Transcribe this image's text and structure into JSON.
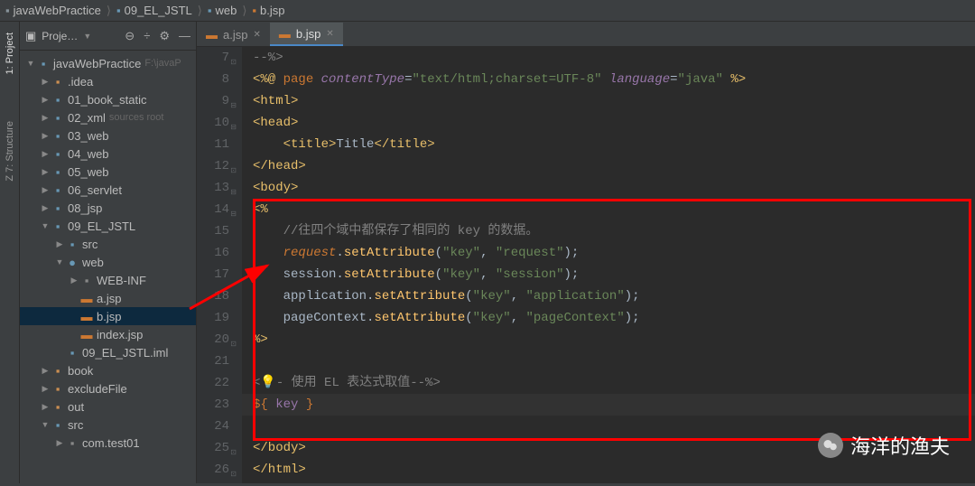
{
  "breadcrumb": [
    "javaWebPractice",
    "09_EL_JSTL",
    "web",
    "b.jsp"
  ],
  "sidebarTabs": [
    {
      "label": "1: Project",
      "active": true
    },
    {
      "label": "Z 7: Structure",
      "active": false
    }
  ],
  "projectPanel": {
    "title": "Proje…",
    "toolbarIcons": [
      "collapse-icon",
      "divide-icon",
      "gear-icon",
      "hide-icon"
    ]
  },
  "tree": [
    {
      "depth": 0,
      "arrow": "down",
      "icon": "project",
      "iconClass": "folder-blue",
      "label": "javaWebPractice",
      "hint": "F:\\javaP"
    },
    {
      "depth": 1,
      "arrow": "right",
      "icon": "folder",
      "iconClass": "folder-orange",
      "label": ".idea"
    },
    {
      "depth": 1,
      "arrow": "right",
      "icon": "module",
      "iconClass": "folder-blue",
      "label": "01_book_static"
    },
    {
      "depth": 1,
      "arrow": "right",
      "icon": "module",
      "iconClass": "folder-blue",
      "label": "02_xml",
      "hint": "sources root"
    },
    {
      "depth": 1,
      "arrow": "right",
      "icon": "module",
      "iconClass": "folder-blue",
      "label": "03_web"
    },
    {
      "depth": 1,
      "arrow": "right",
      "icon": "module",
      "iconClass": "folder-blue",
      "label": "04_web"
    },
    {
      "depth": 1,
      "arrow": "right",
      "icon": "module",
      "iconClass": "folder-blue",
      "label": "05_web"
    },
    {
      "depth": 1,
      "arrow": "right",
      "icon": "module",
      "iconClass": "folder-blue",
      "label": "06_servlet"
    },
    {
      "depth": 1,
      "arrow": "right",
      "icon": "module",
      "iconClass": "folder-blue",
      "label": "08_jsp"
    },
    {
      "depth": 1,
      "arrow": "down",
      "icon": "module",
      "iconClass": "folder-blue",
      "label": "09_EL_JSTL"
    },
    {
      "depth": 2,
      "arrow": "right",
      "icon": "folder",
      "iconClass": "folder-blue",
      "label": "src"
    },
    {
      "depth": 2,
      "arrow": "down",
      "icon": "webfolder",
      "iconClass": "folder-blue",
      "label": "web"
    },
    {
      "depth": 3,
      "arrow": "right",
      "icon": "folder",
      "iconClass": "folder-gray",
      "label": "WEB-INF"
    },
    {
      "depth": 3,
      "arrow": "",
      "icon": "jsp",
      "iconClass": "file-jsp",
      "label": "a.jsp"
    },
    {
      "depth": 3,
      "arrow": "",
      "icon": "jsp",
      "iconClass": "file-jsp",
      "label": "b.jsp",
      "selected": true
    },
    {
      "depth": 3,
      "arrow": "",
      "icon": "jsp",
      "iconClass": "file-jsp",
      "label": "index.jsp"
    },
    {
      "depth": 2,
      "arrow": "",
      "icon": "iml",
      "iconClass": "folder-blue",
      "label": "09_EL_JSTL.iml"
    },
    {
      "depth": 1,
      "arrow": "right",
      "icon": "folder",
      "iconClass": "folder-orange",
      "label": "book"
    },
    {
      "depth": 1,
      "arrow": "right",
      "icon": "folder",
      "iconClass": "folder-orange",
      "label": "excludeFile"
    },
    {
      "depth": 1,
      "arrow": "right",
      "icon": "folder",
      "iconClass": "folder-orange",
      "label": "out"
    },
    {
      "depth": 1,
      "arrow": "down",
      "icon": "folder",
      "iconClass": "folder-blue",
      "label": "src"
    },
    {
      "depth": 2,
      "arrow": "right",
      "icon": "package",
      "iconClass": "folder-gray",
      "label": "com.test01"
    }
  ],
  "editorTabs": [
    {
      "label": "a.jsp",
      "active": false
    },
    {
      "label": "b.jsp",
      "active": true
    }
  ],
  "code": {
    "startLine": 7,
    "lines": [
      {
        "raw": "--%>",
        "fold": "close"
      },
      {
        "raw": "<%@ page contentType=\"text/html;charset=UTF-8\" language=\"java\" %>"
      },
      {
        "raw": "<html>",
        "fold": "open"
      },
      {
        "raw": "<head>",
        "fold": "open"
      },
      {
        "raw": "    <title>Title</title>"
      },
      {
        "raw": "</head>",
        "fold": "close"
      },
      {
        "raw": "<body>",
        "fold": "open"
      },
      {
        "raw": "<%",
        "fold": "open"
      },
      {
        "raw": "    //往四个域中都保存了相同的 key 的数据。"
      },
      {
        "raw": "    request.setAttribute(\"key\", \"request\");"
      },
      {
        "raw": "    session.setAttribute(\"key\", \"session\");"
      },
      {
        "raw": "    application.setAttribute(\"key\", \"application\");"
      },
      {
        "raw": "    pageContext.setAttribute(\"key\", \"pageContext\");"
      },
      {
        "raw": "%>",
        "fold": "close"
      },
      {
        "raw": ""
      },
      {
        "raw": "<%-- 使用 EL 表达式取值--%>",
        "bulb": true
      },
      {
        "raw": "${ key }",
        "highlighted": true
      },
      {
        "raw": ""
      },
      {
        "raw": "</body>",
        "fold": "close"
      },
      {
        "raw": "</html>",
        "fold": "close"
      }
    ]
  },
  "watermark": "海洋的渔夫"
}
